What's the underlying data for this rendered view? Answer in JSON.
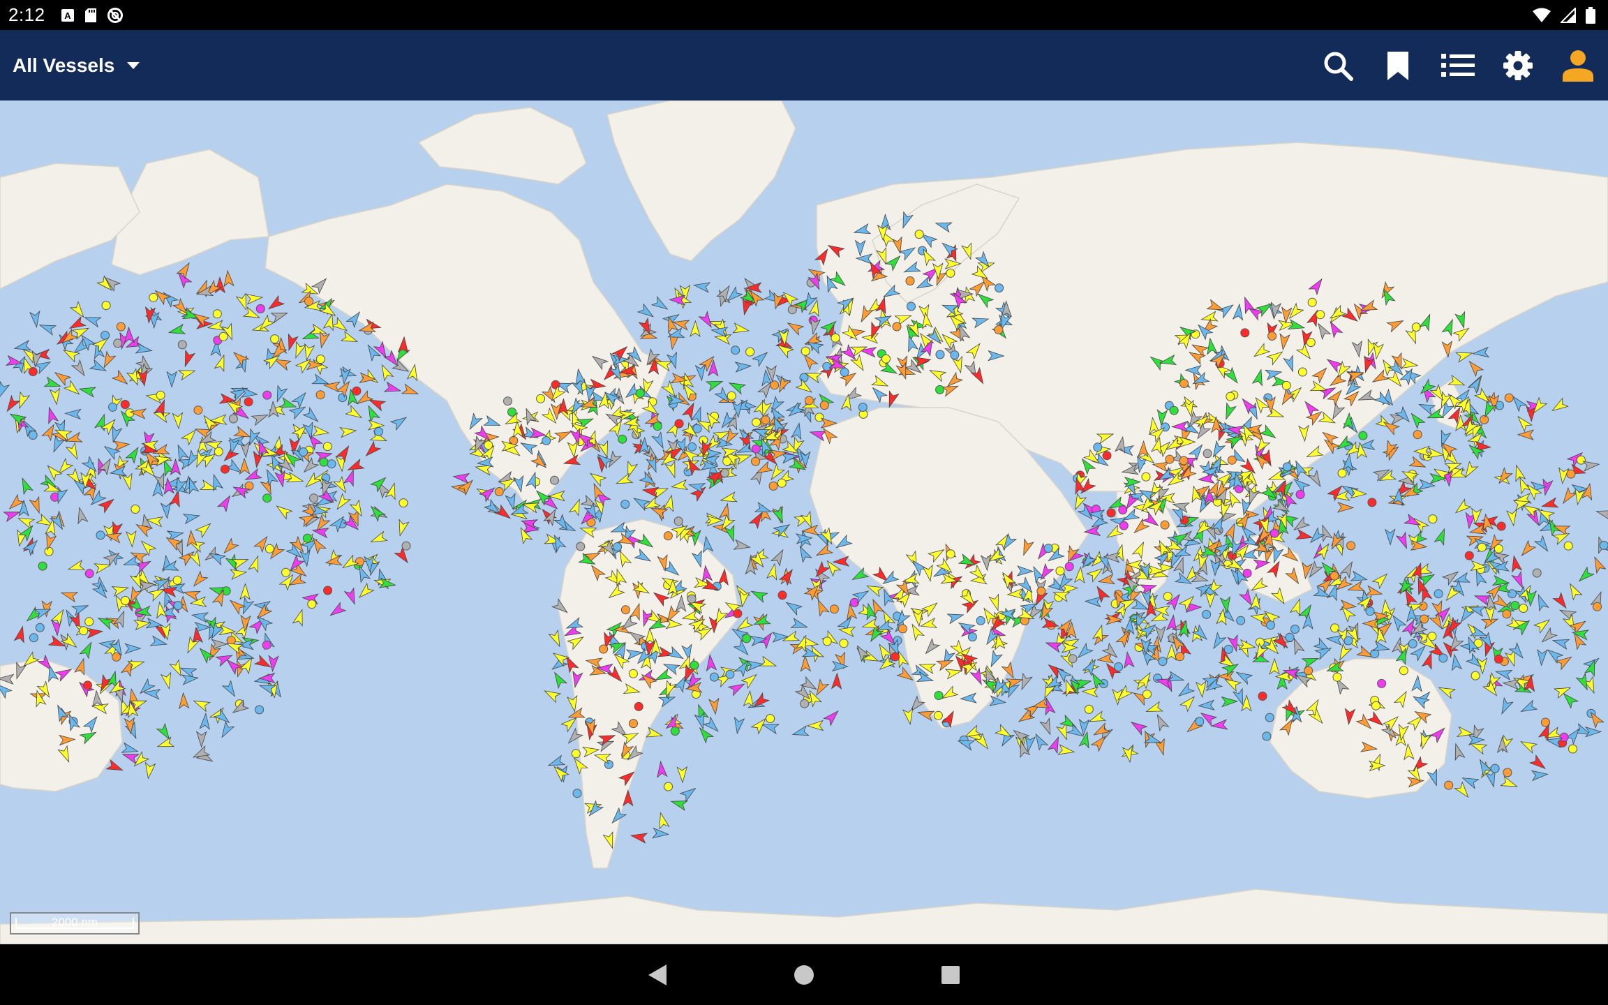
{
  "status_bar": {
    "time": "2:12",
    "left_icons": [
      "a-notification-icon",
      "sd-card-icon",
      "sync-disabled-icon"
    ],
    "right_icons": [
      "wifi-icon",
      "cellular-signal-icon",
      "battery-icon"
    ]
  },
  "app_bar": {
    "filter_label": "All Vessels",
    "filter_icon": "dropdown-caret-icon",
    "actions": [
      {
        "name": "search-button",
        "icon": "search-icon"
      },
      {
        "name": "bookmark-button",
        "icon": "bookmark-icon"
      },
      {
        "name": "list-button",
        "icon": "list-icon"
      },
      {
        "name": "settings-button",
        "icon": "gear-icon"
      },
      {
        "name": "account-button",
        "icon": "person-icon"
      }
    ],
    "colors": {
      "background": "#122b58",
      "account_icon": "#f5a623"
    }
  },
  "map": {
    "scale_label": "2000 nm",
    "colors": {
      "ocean": "#b6d0ee",
      "land": "#f2f0e8",
      "cargo": "#ffff2a",
      "tanker": "#ff9c33",
      "fishing": "#6ab8ee",
      "passenger": "#f03cf0",
      "pleasure": "#2fe03b",
      "unknown": "#b0b0b0",
      "high_speed": "#ff2a2a"
    }
  },
  "nav_bar": {
    "buttons": [
      "back-icon",
      "home-icon",
      "recents-icon"
    ]
  }
}
